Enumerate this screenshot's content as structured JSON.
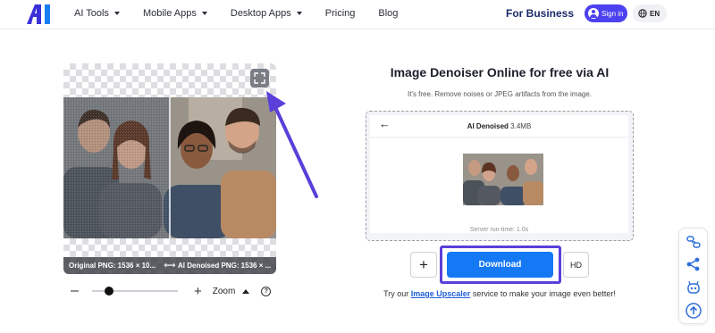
{
  "header": {
    "nav": [
      {
        "label": "AI Tools",
        "has_dropdown": true
      },
      {
        "label": "Mobile Apps",
        "has_dropdown": true
      },
      {
        "label": "Desktop Apps",
        "has_dropdown": true
      },
      {
        "label": "Pricing",
        "has_dropdown": false
      },
      {
        "label": "Blog",
        "has_dropdown": false
      }
    ],
    "for_business": "For Business",
    "sign_in": "Sign in",
    "language": "EN",
    "brand_color": "#4c41f0"
  },
  "compare": {
    "left_label": "Original PNG: 1536 × 10...",
    "right_label": "AI Denoised PNG: 1536 × ..."
  },
  "zoom": {
    "label": "Zoom",
    "level": 0.2
  },
  "result": {
    "title": "Image Denoiser Online for free via AI",
    "subtitle": "It's free. Remove noises or JPEG artifacts from the image.",
    "panel_label": "AI Denoised",
    "file_size": "3.4MB",
    "runtime": "Server run-time: 1.0s",
    "download": "Download",
    "hd": "HD",
    "promo_prefix": "Try our",
    "promo_link": "Image Upscaler",
    "promo_suffix": "service to make your image even better!",
    "download_color": "#1579f5",
    "highlight_color": "#5b3fd9"
  },
  "floating_tools": [
    "link-share-icon",
    "share-icon",
    "robot-icon",
    "scroll-top-icon"
  ]
}
